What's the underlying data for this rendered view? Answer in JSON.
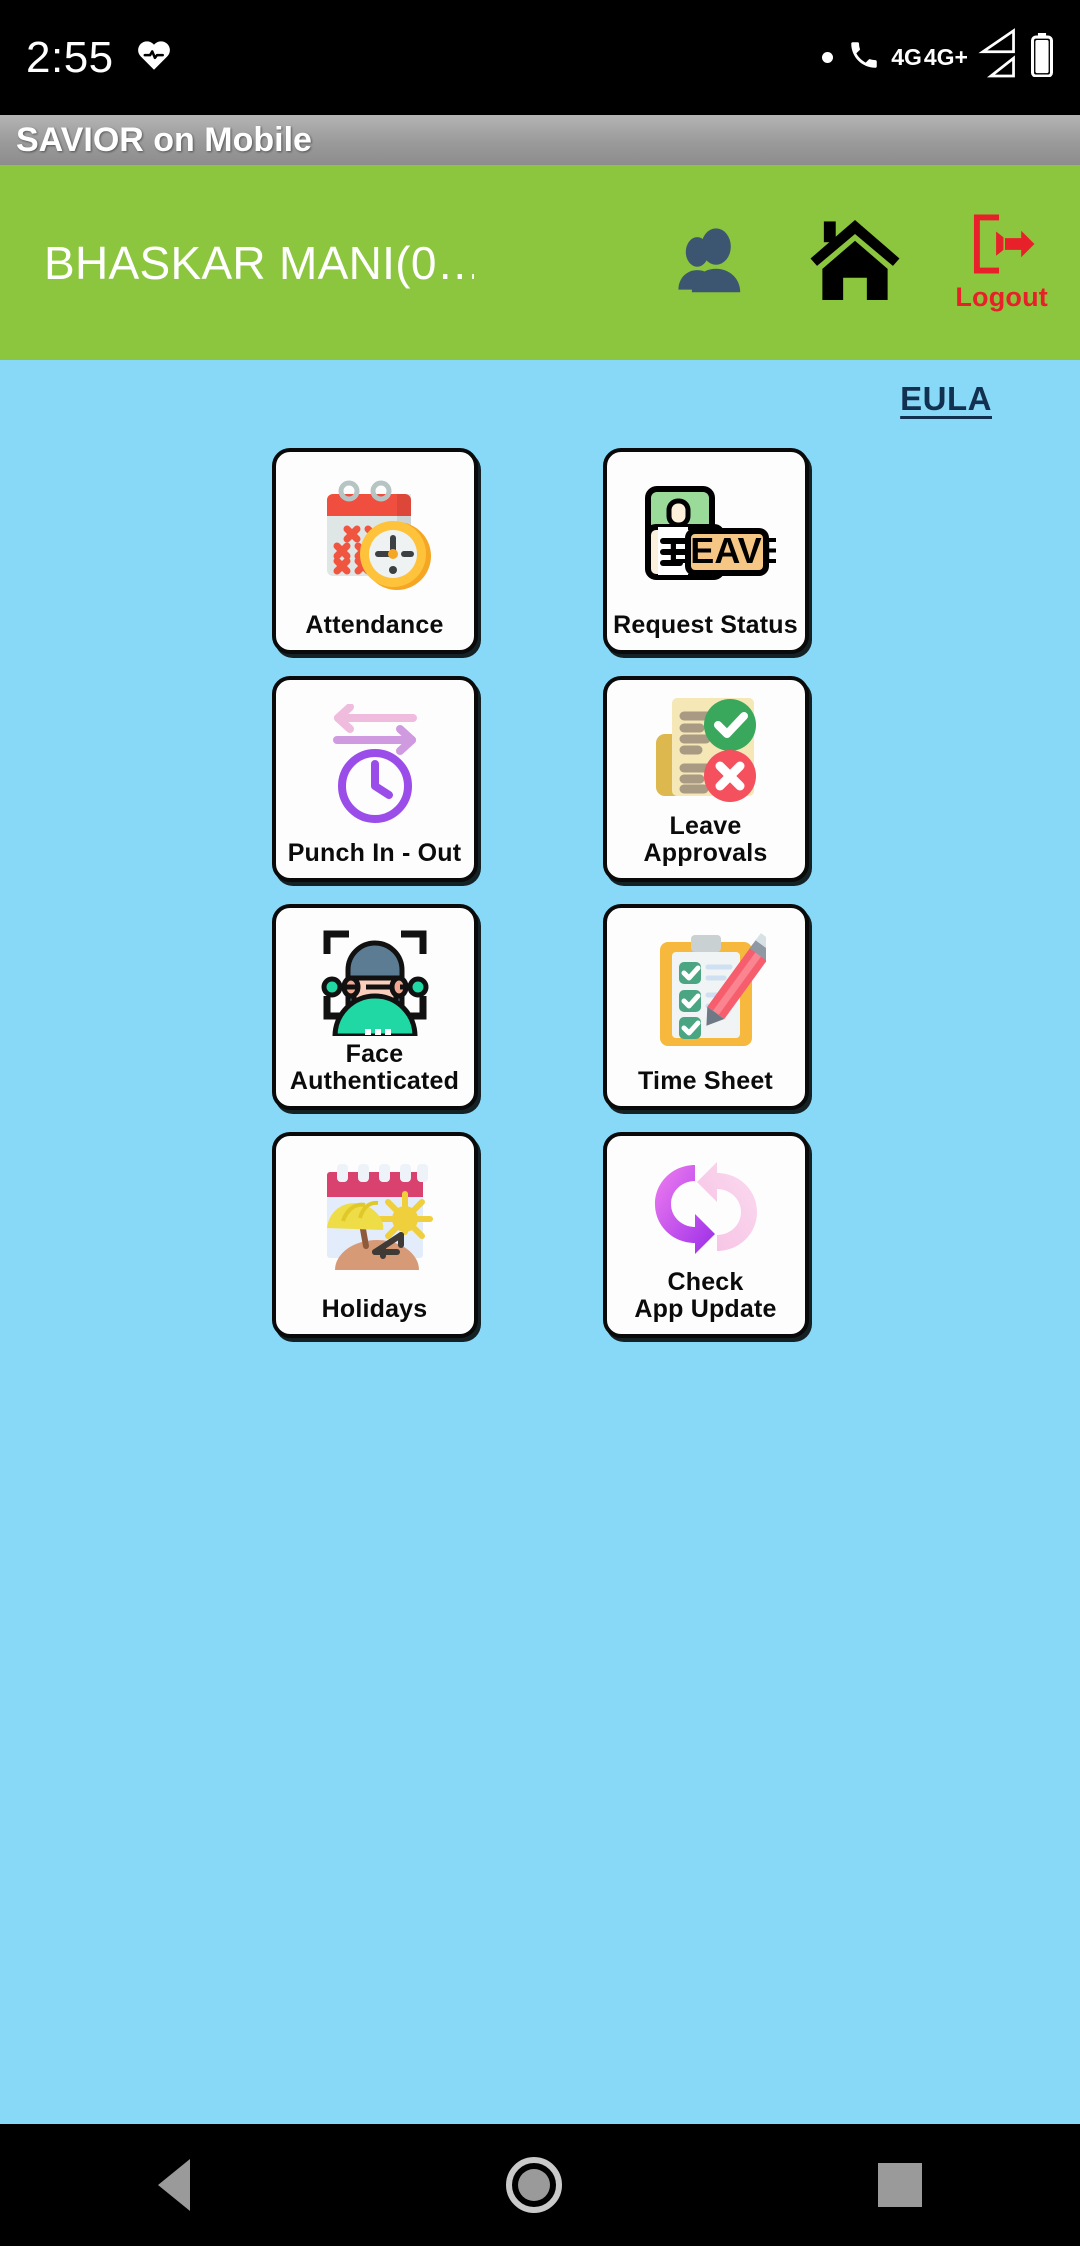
{
  "status_bar": {
    "time": "2:55",
    "heart_icon": "heart-pulse-icon",
    "network_primary": "4G",
    "network_secondary": "4G+",
    "battery_icon": "battery-icon"
  },
  "app_bar": {
    "title": "SAVIOR on Mobile"
  },
  "header": {
    "username": "BHASKAR MANI(0…",
    "users_icon": "users-icon",
    "home_icon": "home-icon",
    "logout_icon": "logout-icon",
    "logout_label": "Logout",
    "background_color": "#8cc63e"
  },
  "content": {
    "eula_label": "EULA",
    "background_color": "#87d9f7",
    "tiles": [
      {
        "label": "Attendance",
        "icon": "calendar-clock-icon"
      },
      {
        "label": "Request  Status",
        "icon": "leave-request-icon"
      },
      {
        "label": "Punch In - Out",
        "icon": "clock-arrows-icon"
      },
      {
        "label": "Leave Approvals",
        "icon": "approve-reject-icon"
      },
      {
        "label": "Face\nAuthenticated",
        "icon": "face-scan-icon"
      },
      {
        "label": "Time  Sheet",
        "icon": "clipboard-pencil-icon"
      },
      {
        "label": "Holidays",
        "icon": "beach-calendar-icon"
      },
      {
        "label": "Check\nApp  Update",
        "icon": "refresh-arrows-icon"
      }
    ]
  },
  "nav_bar": {
    "back_label": "back-icon",
    "home_label": "home-circle-icon",
    "recents_label": "recents-square-icon"
  }
}
